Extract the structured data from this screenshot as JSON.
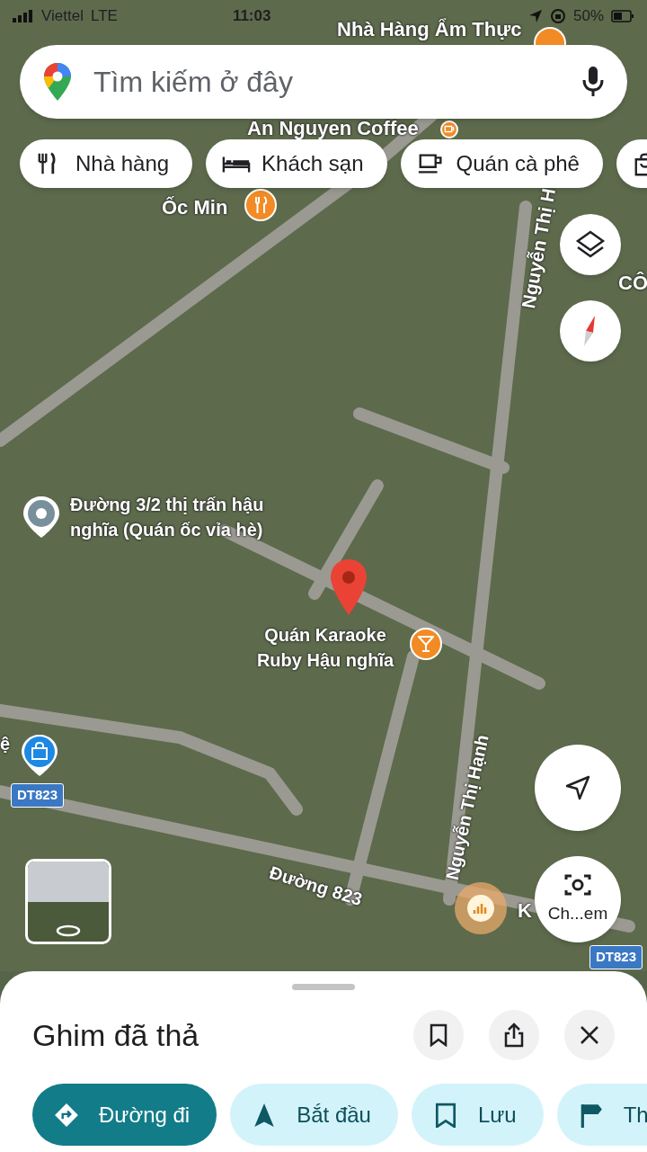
{
  "status_bar": {
    "carrier": "Viettel",
    "network": "LTE",
    "time": "11:03",
    "battery": "50%"
  },
  "search": {
    "placeholder": "Tìm kiếm ở đây"
  },
  "categories": [
    {
      "kind": "labeled",
      "label": "Nhà hàng"
    },
    {
      "kind": "labeled",
      "label": "Khách sạn"
    },
    {
      "kind": "labeled",
      "label": "Quán cà phê"
    },
    {
      "kind": "cut"
    }
  ],
  "map": {
    "labels": [
      {
        "kind": "label",
        "text": "Nhà Hàng Ẩm Thực"
      },
      {
        "kind": "label",
        "text": "An Nguyen Coffee"
      },
      {
        "kind": "label",
        "text": "Ốc Min"
      },
      {
        "kind": "label",
        "text": "Nguyễn Thị H"
      },
      {
        "kind": "label",
        "text": "CÔ"
      },
      {
        "kind": "label",
        "text": "Đường 3/2 thị trấn hậu nghĩa (Quán ốc vỉa hè)"
      },
      {
        "kind": "label",
        "text": "Quán Karaoke Ruby Hậu nghĩa"
      },
      {
        "kind": "label",
        "text": "ệ"
      },
      {
        "kind": "badge",
        "text": "DT823"
      },
      {
        "kind": "label",
        "text": "Nguyễn Thị Hạnh"
      },
      {
        "kind": "label",
        "text": "Đường 823"
      },
      {
        "kind": "label",
        "text": "K"
      },
      {
        "kind": "badge",
        "text": "DT823"
      }
    ]
  },
  "camera_button": {
    "label": "Ch...em"
  },
  "sheet": {
    "title": "Ghim đã thả",
    "actions": [
      {
        "label": "Đường đi",
        "primary": true
      },
      {
        "label": "Bắt đầu",
        "primary": false
      },
      {
        "label": "Lưu",
        "primary": false
      },
      {
        "label": "Th",
        "primary": false
      }
    ]
  }
}
